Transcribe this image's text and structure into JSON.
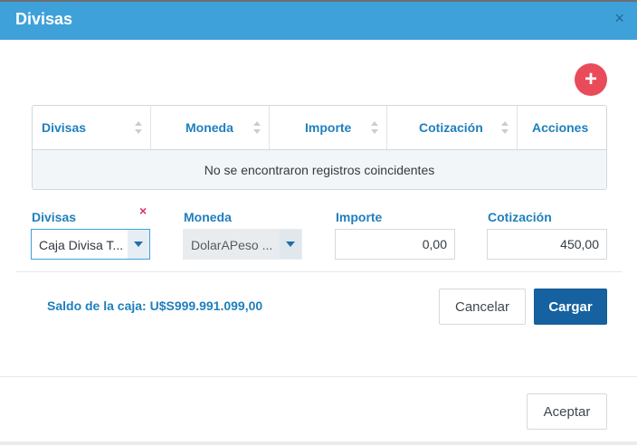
{
  "modal": {
    "title": "Divisas",
    "close_glyph": "×"
  },
  "add_button": {
    "glyph": "+",
    "icon": "plus-icon",
    "color": "#ea4b5a"
  },
  "table": {
    "columns": [
      {
        "label": "Divisas",
        "sortable": true
      },
      {
        "label": "Moneda",
        "sortable": true
      },
      {
        "label": "Importe",
        "sortable": true
      },
      {
        "label": "Cotización",
        "sortable": true
      },
      {
        "label": "Acciones",
        "sortable": false
      }
    ],
    "empty_message": "No se encontraron registros coincidentes"
  },
  "form": {
    "divisas": {
      "label": "Divisas",
      "value": "Caja Divisa T...",
      "remove_glyph": "×"
    },
    "moneda": {
      "label": "Moneda",
      "value": "DolarAPeso ..."
    },
    "importe": {
      "label": "Importe",
      "value": "0,00"
    },
    "cotizacion": {
      "label": "Cotización",
      "value": "450,00"
    }
  },
  "saldo_text": "Saldo de la caja: U$S999.991.099,00",
  "buttons": {
    "cancelar": "Cancelar",
    "cargar": "Cargar",
    "aceptar": "Aceptar"
  },
  "colors": {
    "header": "#3fa1d9",
    "accent": "#1f7fbd",
    "primary_button": "#1662a0",
    "danger": "#e0306a"
  }
}
